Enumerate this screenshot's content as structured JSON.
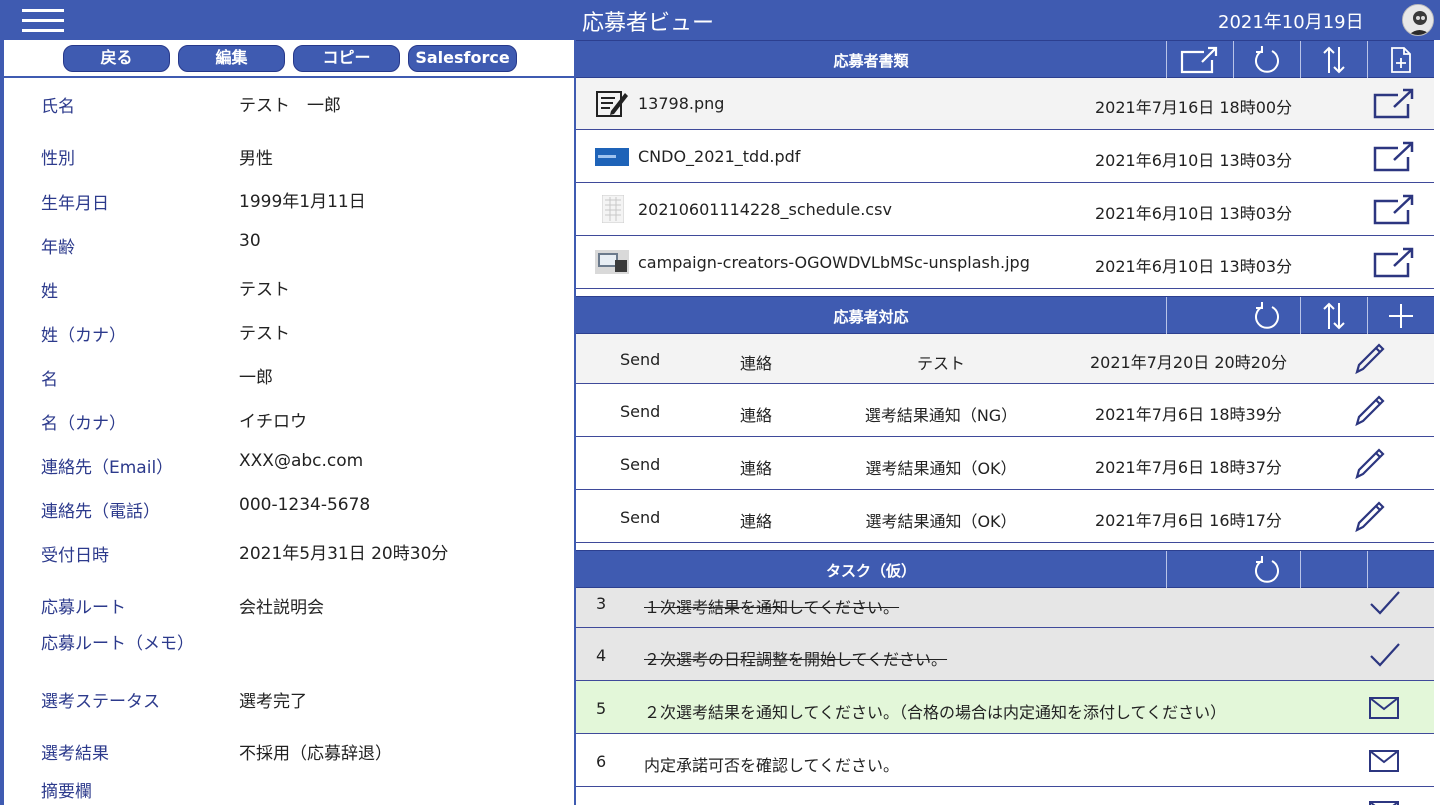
{
  "header": {
    "title": "応募者ビュー",
    "date": "2021年10月19日"
  },
  "toolbar": {
    "back": "戻る",
    "edit": "編集",
    "copy": "コピー",
    "salesforce": "Salesforce"
  },
  "fields": [
    {
      "label": "氏名",
      "value": "テスト　一郎"
    },
    {
      "label": "性別",
      "value": "男性"
    },
    {
      "label": "生年月日",
      "value": "1999年1月11日"
    },
    {
      "label": "年齢",
      "value": "30"
    },
    {
      "label": "姓",
      "value": "テスト"
    },
    {
      "label": "姓（カナ）",
      "value": "テスト"
    },
    {
      "label": "名",
      "value": "一郎"
    },
    {
      "label": "名（カナ）",
      "value": "イチロウ"
    },
    {
      "label": "連絡先（Email）",
      "value": "XXX@abc.com"
    },
    {
      "label": "連絡先（電話）",
      "value": "000-1234-5678"
    },
    {
      "label": "受付日時",
      "value": "2021年5月31日 20時30分"
    },
    {
      "label": "応募ルート",
      "value": "会社説明会"
    },
    {
      "label": "応募ルート（メモ）",
      "value": ""
    },
    {
      "label": "選考ステータス",
      "value": "選考完了"
    },
    {
      "label": "選考結果",
      "value": "不採用（応募辞退）"
    },
    {
      "label": "摘要欄",
      "value": ""
    }
  ],
  "documents": {
    "title": "応募者書類",
    "rows": [
      {
        "name": "13798.png",
        "date": "2021年7月16日 18時00分",
        "thumb": "edit-document-icon"
      },
      {
        "name": "CNDO_2021_tdd.pdf",
        "date": "2021年6月10日 13時03分",
        "thumb": "pdf-banner-thumbnail"
      },
      {
        "name": "20210601114228_schedule.csv",
        "date": "2021年6月10日 13時03分",
        "thumb": "csv-thumbnail"
      },
      {
        "name": "campaign-creators-OGOWDVLbMSc-unsplash.jpg",
        "date": "2021年6月10日 13時03分",
        "thumb": "photo-thumbnail"
      }
    ]
  },
  "responses": {
    "title": "応募者対応",
    "rows": [
      {
        "type": "Send",
        "kind": "連絡",
        "subject": "テスト",
        "date": "2021年7月20日 20時20分"
      },
      {
        "type": "Send",
        "kind": "連絡",
        "subject": "選考結果通知（NG）",
        "date": "2021年7月6日 18時39分"
      },
      {
        "type": "Send",
        "kind": "連絡",
        "subject": "選考結果通知（OK）",
        "date": "2021年7月6日 18時37分"
      },
      {
        "type": "Send",
        "kind": "連絡",
        "subject": "選考結果通知（OK）",
        "date": "2021年7月6日 16時17分"
      }
    ]
  },
  "tasks": {
    "title": "タスク（仮）",
    "rows": [
      {
        "no": "3",
        "text": "１次選考結果を通知してください。",
        "done": true
      },
      {
        "no": "4",
        "text": "２次選考の日程調整を開始してください。",
        "done": true
      },
      {
        "no": "5",
        "text": "２次選考結果を通知してください。（合格の場合は内定通知を添付してください）",
        "done": false,
        "highlight": true
      },
      {
        "no": "6",
        "text": "内定承諾可否を確認してください。",
        "done": false
      }
    ]
  },
  "colors": {
    "primary": "#3f5bb1",
    "label_text": "#2c3a8c",
    "done_row": "#e6e6e6",
    "highlight_row": "#e3f7d9"
  }
}
